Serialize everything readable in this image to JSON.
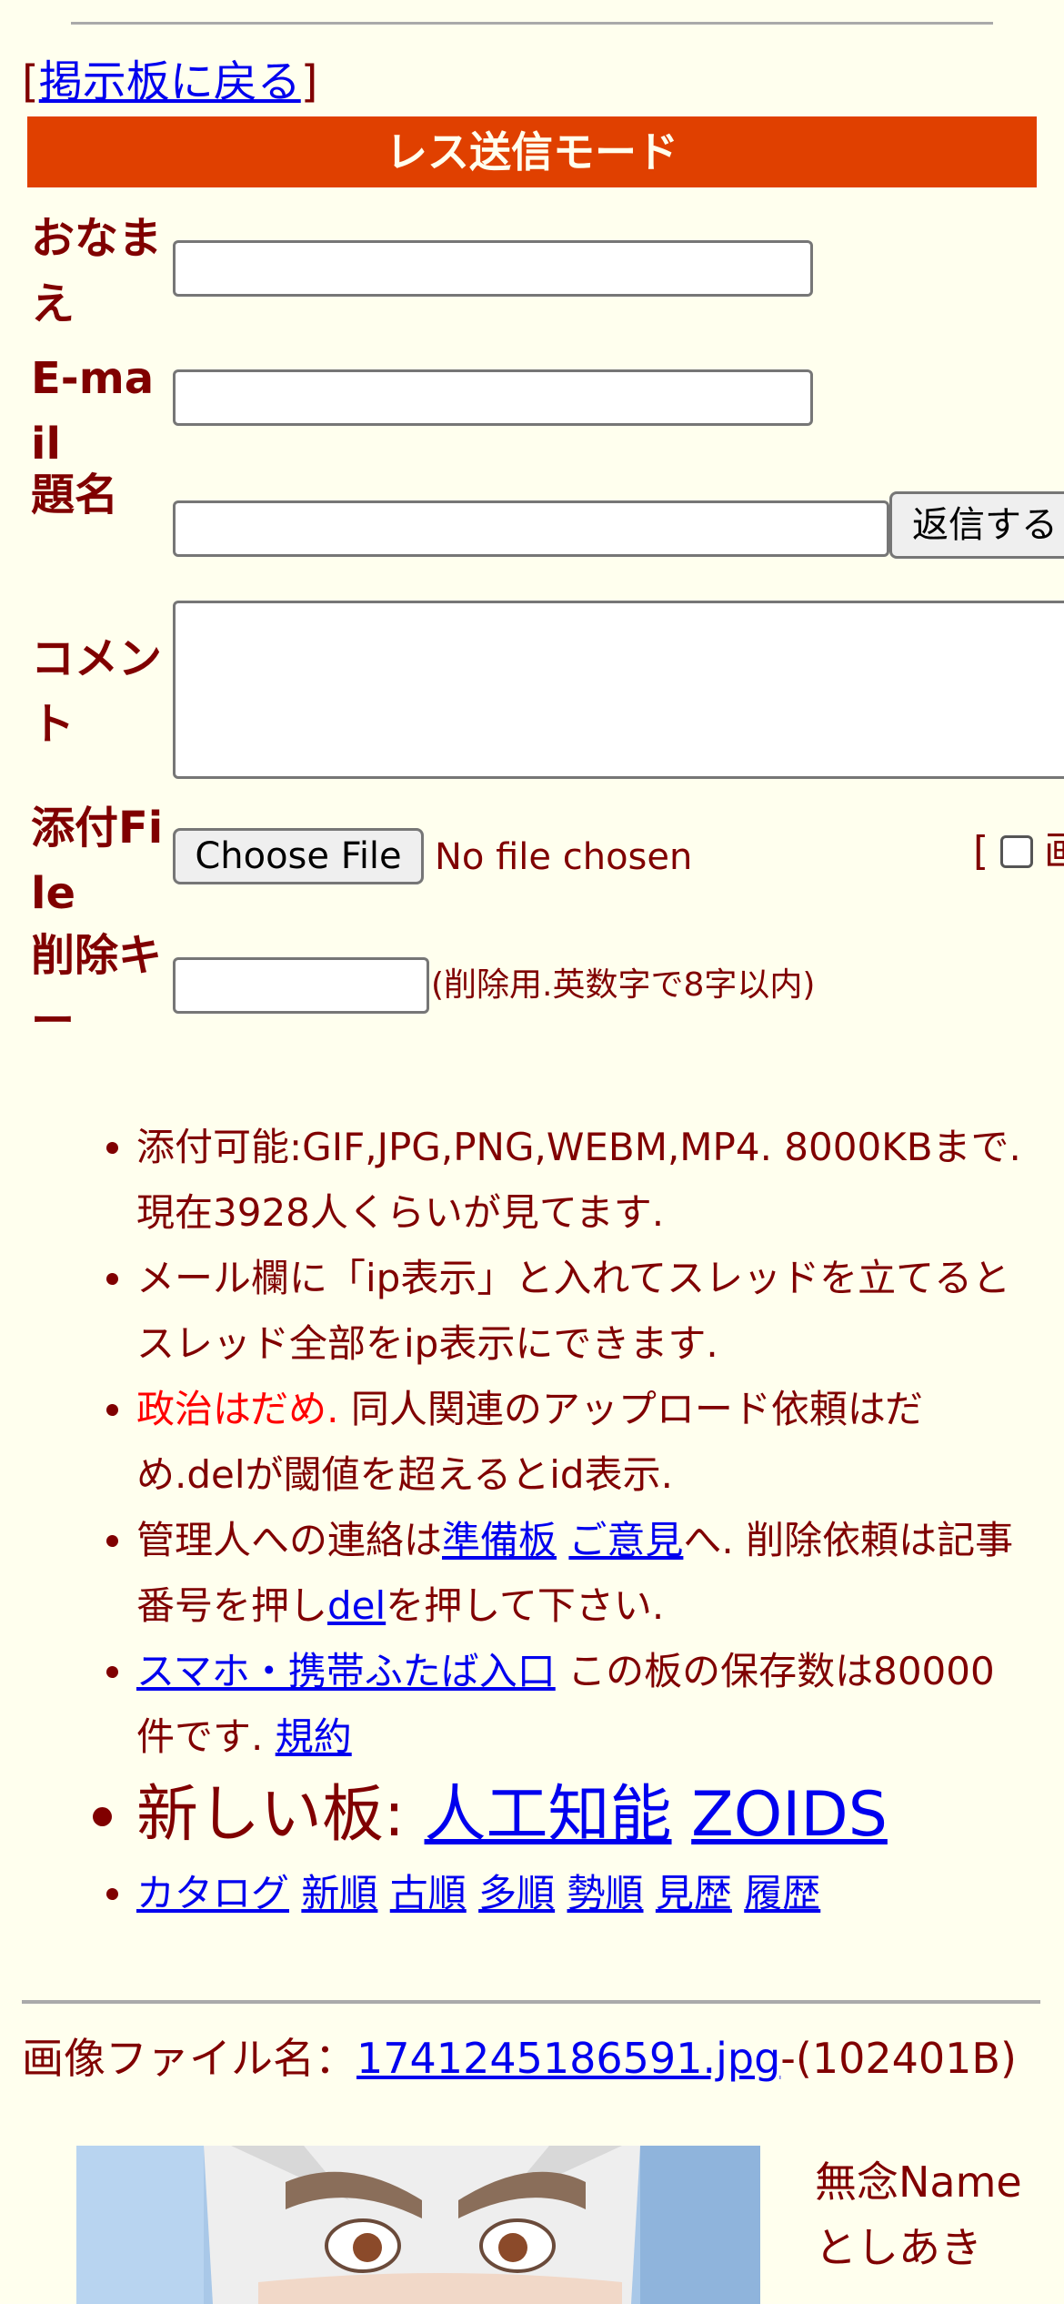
{
  "back_link": {
    "open": "[",
    "label": "掲示板に戻る",
    "close": "]"
  },
  "banner": "レス送信モード",
  "form": {
    "name_label": "おなまえ",
    "email_label": "E-mail",
    "subject_label": "題名",
    "submit_label": "返信する",
    "comment_label": "コメント",
    "file_label": "添付File",
    "choose_file_label": "Choose File",
    "no_file_text": "No file chosen",
    "image_option_bracket": "[",
    "image_option_partial": "画",
    "delkey_label": "削除キー",
    "delkey_note": "(削除用.英数字で8字以内)"
  },
  "info": {
    "line1": "添付可能:GIF,JPG,PNG,WEBM,MP4. 8000KBまで. 現在3928人くらいが見てます.",
    "line2": "メール欄に「ip表示」と入れてスレッドを立てるとスレッド全部をip表示にできます.",
    "line3_red": "政治はだめ.",
    "line3_rest": " 同人関連のアップロード依頼はだめ.delが閾値を超えるとid表示.",
    "line4_a": "管理人への連絡は",
    "line4_link1": "準備板",
    "line4_link2": "ご意見",
    "line4_b": "へ. 削除依頼は記事番号を押し",
    "line4_link3": "del",
    "line4_c": "を押して下さい.",
    "line5_link": "スマホ・携帯ふたば入口",
    "line5_text": " この板の保存数は80000件です. ",
    "line5_link2": "規約",
    "line6_prefix": "新しい板: ",
    "line6_link1": "人工知能",
    "line6_link2": "ZOIDS",
    "nav": [
      "カタログ",
      "新順",
      "古順",
      "多順",
      "勢順",
      "見歴",
      "履歴"
    ]
  },
  "post": {
    "file_prefix": "画像ファイル名：",
    "file_name": "1741245186591.jpg",
    "file_size": "-(102401B)",
    "name": "無念Name",
    "poster": "としあき"
  }
}
